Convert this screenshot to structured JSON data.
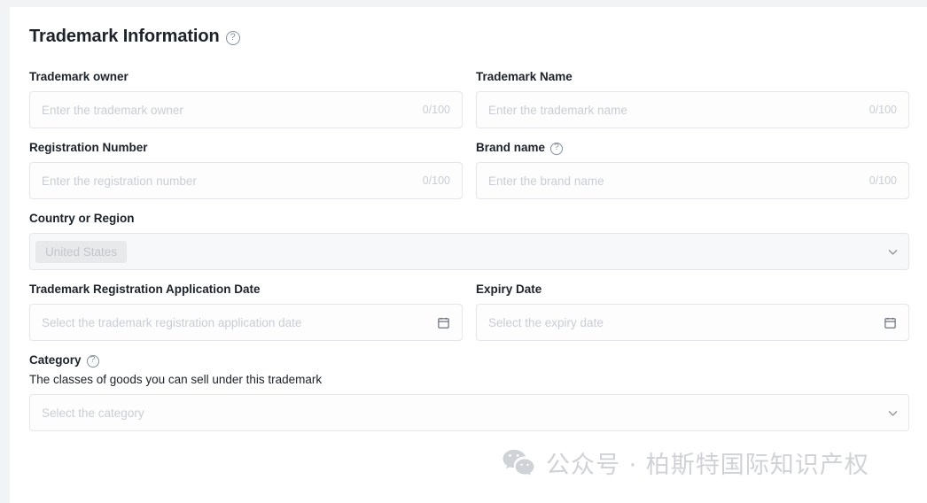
{
  "section": {
    "title": "Trademark Information",
    "help_icon": "question-circle-icon"
  },
  "fields": {
    "trademark_owner": {
      "label": "Trademark owner",
      "placeholder": "Enter the trademark owner",
      "counter": "0/100",
      "value": ""
    },
    "trademark_name": {
      "label": "Trademark Name",
      "placeholder": "Enter the trademark name",
      "counter": "0/100",
      "value": ""
    },
    "registration_number": {
      "label": "Registration Number",
      "placeholder": "Enter the registration number",
      "counter": "0/100",
      "value": ""
    },
    "brand_name": {
      "label": "Brand name",
      "placeholder": "Enter the brand name",
      "counter": "0/100",
      "value": ""
    },
    "country_or_region": {
      "label": "Country or Region",
      "selected_tag": "United States",
      "chevron_icon": "chevron-down-icon"
    },
    "application_date": {
      "label": "Trademark Registration Application Date",
      "placeholder": "Select the trademark registration application date",
      "calendar_icon": "calendar-icon",
      "value": ""
    },
    "expiry_date": {
      "label": "Expiry Date",
      "placeholder": "Select the expiry date",
      "calendar_icon": "calendar-icon",
      "value": ""
    },
    "category": {
      "label": "Category",
      "helper_text": "The classes of goods you can sell under this trademark",
      "placeholder": "Select the category",
      "chevron_icon": "chevron-down-icon",
      "value": ""
    }
  },
  "watermark": {
    "logo_icon": "wechat-logo-icon",
    "text": "公众号 · 柏斯特国际知识产权"
  },
  "colors": {
    "page_background": "#f2f3f5",
    "card_background": "#ffffff",
    "border": "#e5e6eb",
    "text_primary": "#1d2129",
    "placeholder": "#c9cdd4",
    "chip_background": "#e8e9eb",
    "watermark": "#cfd2d6"
  },
  "help_glyph": "?"
}
